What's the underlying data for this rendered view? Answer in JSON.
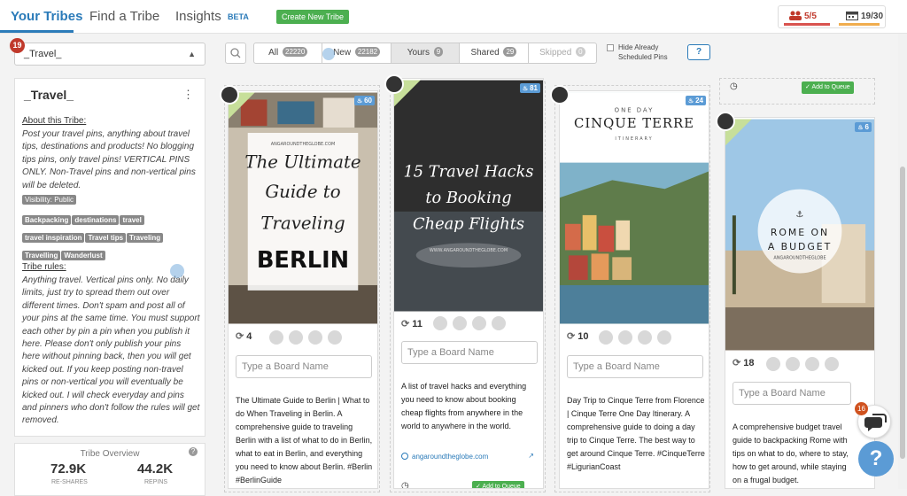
{
  "nav": {
    "tabs": [
      {
        "label": "Your Tribes"
      },
      {
        "label": "Find a Tribe"
      },
      {
        "label": "Insights"
      }
    ],
    "beta": "BETA",
    "create_button": "Create New Tribe"
  },
  "stats": {
    "members": "5/5",
    "scheduled": "19/30",
    "members_icon": "people-icon",
    "scheduled_icon": "calendar-icon",
    "colors": {
      "red": "#d9534f",
      "orange": "#f0ad4e"
    }
  },
  "sidebar": {
    "tribe_count": "19",
    "selected_tribe": "_Travel_",
    "title": "_Travel_",
    "about_title": "About this Tribe:",
    "about_text": "Post your travel pins, anything about travel tips, destinations and products! No blogging tips pins, only travel pins! VERTICAL PINS ONLY. Non-Travel pins and non-vertical pins will be deleted.",
    "visibility": "Visibility: Public",
    "tags": [
      "Backpacking",
      "destinations",
      "travel",
      "travel inspiration",
      "Travel tips",
      "Traveling",
      "Travelling",
      "Wanderlust"
    ],
    "rules_title": "Tribe rules:",
    "rules_text": "Anything travel. Vertical pins only. No daily limits, just try to spread them out over different times. Don't spam and post all of your pins at the same time. You must support each other by pin a pin when you publish it here. Please don't only publish your pins here without pinning back, then you will get kicked out. If you keep posting non-travel pins or non-vertical you will eventually be kicked out. I will check everyday and pins and pinners who don't follow the rules will get removed.",
    "overview": {
      "title": "Tribe Overview",
      "reshares": "72.9K",
      "reshares_label": "RE-SHARES",
      "repins": "44.2K",
      "repins_label": "REPINS"
    }
  },
  "filters": [
    {
      "label": "All",
      "count": "22220"
    },
    {
      "label": "New",
      "count": "22182"
    },
    {
      "label": "Yours",
      "count": "9"
    },
    {
      "label": "Shared",
      "count": "29"
    },
    {
      "label": "Skipped",
      "count": "0"
    }
  ],
  "hide_label": "Hide Already Scheduled Pins",
  "help_label": "?",
  "queue_label": "Add to Queue",
  "board_placeholder": "Type a Board Name",
  "pins": [
    {
      "count": "60",
      "img_title_1": "The Ultimate",
      "img_title_2": "Guide to",
      "img_title_3": "Traveling",
      "img_title_4": "BERLIN",
      "img_site": "ANGAROUNDTHEGLOBE.COM",
      "reshares": "4",
      "desc": "The Ultimate Guide to Berlin | What to do When Traveling in Berlin. A comprehensive guide to traveling Berlin with a list of what to do in Berlin, what to eat in Berlin, and everything you need to know about Berlin. #Berlin #BerlinGuide"
    },
    {
      "count": "81",
      "img_title_1": "15 Travel Hacks",
      "img_title_2": "to Booking",
      "img_title_3": "Cheap Flights",
      "img_site": "WWW.ANGAROUNDTHEGLOBE.COM",
      "reshares": "11",
      "desc": "A list of travel hacks and everything you need to know about booking cheap flights from anywhere in the world to anywhere in the world.",
      "link": "angaroundtheglobe.com"
    },
    {
      "count": "24",
      "img_kicker": "ONE DAY",
      "img_title_1": "CINQUE TERRE",
      "img_sub": "ITINERARY",
      "reshares": "10",
      "desc": "Day Trip to Cinque Terre from Florence | Cinque Terre One Day Itinerary. A comprehensive guide to doing a day trip to Cinque Terre. The best way to get around Cinque Terre. #CinqueTerre #LigurianCoast"
    },
    {
      "count": "6",
      "img_title_1": "ROME ON",
      "img_title_2": "A BUDGET",
      "img_site": "ANGAROUNDTHEGLOBE",
      "reshares": "18",
      "desc": "A comprehensive budget travel guide to backpacking Rome with tips on what to do, where to stay, how to get around, while staying on a frugal budget."
    }
  ],
  "chat_badge": "16",
  "help_float": "?"
}
